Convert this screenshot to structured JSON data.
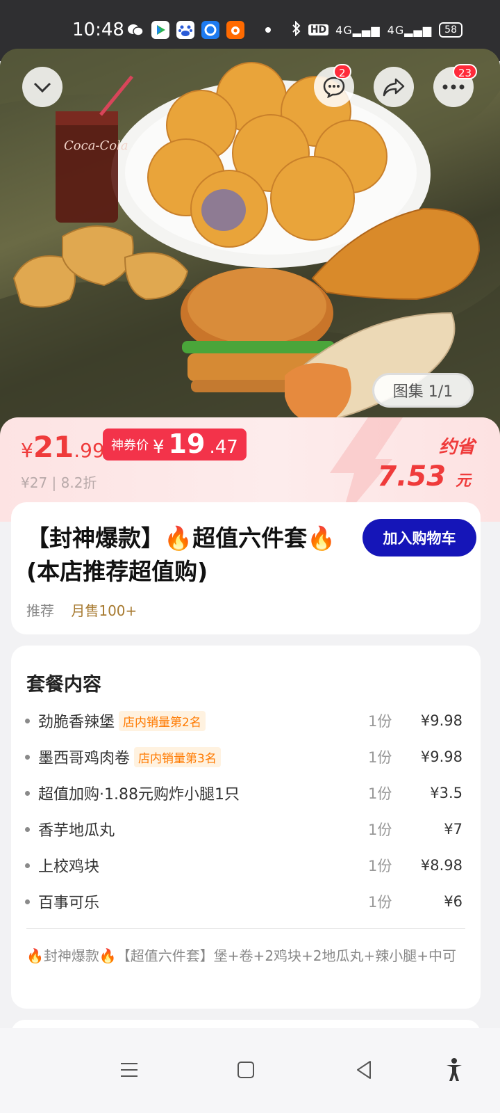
{
  "status_bar": {
    "time": "10:48",
    "network": "4G",
    "hd_label": "HD",
    "battery": "58"
  },
  "hero": {
    "message_badge": "2",
    "more_badge": "23",
    "gallery_label": "图集 1/1"
  },
  "price": {
    "currency": "¥",
    "main_int": "21",
    "main_dec": ".99",
    "coupon_label": "神券价",
    "coupon_int": "19",
    "coupon_dec": ".47",
    "original": "¥27 | 8.2折",
    "save_label": "约省",
    "save_value": "7.53",
    "save_unit": "元"
  },
  "product": {
    "title": "【封神爆款】🔥超值六件套🔥(本店推荐超值购)",
    "cart_button": "加入购物车",
    "recommend": "推荐",
    "monthly_sales": "月售100+"
  },
  "combo": {
    "title": "套餐内容",
    "items": [
      {
        "name": "劲脆香辣堡",
        "tag": "店内销量第2名",
        "qty": "1份",
        "price": "¥9.98"
      },
      {
        "name": "墨西哥鸡肉卷",
        "tag": "店内销量第3名",
        "qty": "1份",
        "price": "¥9.98"
      },
      {
        "name": "超值加购·1.88元购炸小腿1只",
        "tag": "",
        "qty": "1份",
        "price": "¥3.5"
      },
      {
        "name": "香芋地瓜丸",
        "tag": "",
        "qty": "1份",
        "price": "¥7"
      },
      {
        "name": "上校鸡块",
        "tag": "",
        "qty": "1份",
        "price": "¥8.98"
      },
      {
        "name": "百事可乐",
        "tag": "",
        "qty": "1份",
        "price": "¥6"
      }
    ],
    "description": "🔥封神爆款🔥【超值六件套】堡+卷+2鸡块+2地瓜丸+辣小腿+中可"
  },
  "colors": {
    "accent_red": "#ef3b3b",
    "coupon_red": "#f3334a",
    "cart_blue": "#1515b8",
    "tag_orange": "#ff7a00"
  }
}
